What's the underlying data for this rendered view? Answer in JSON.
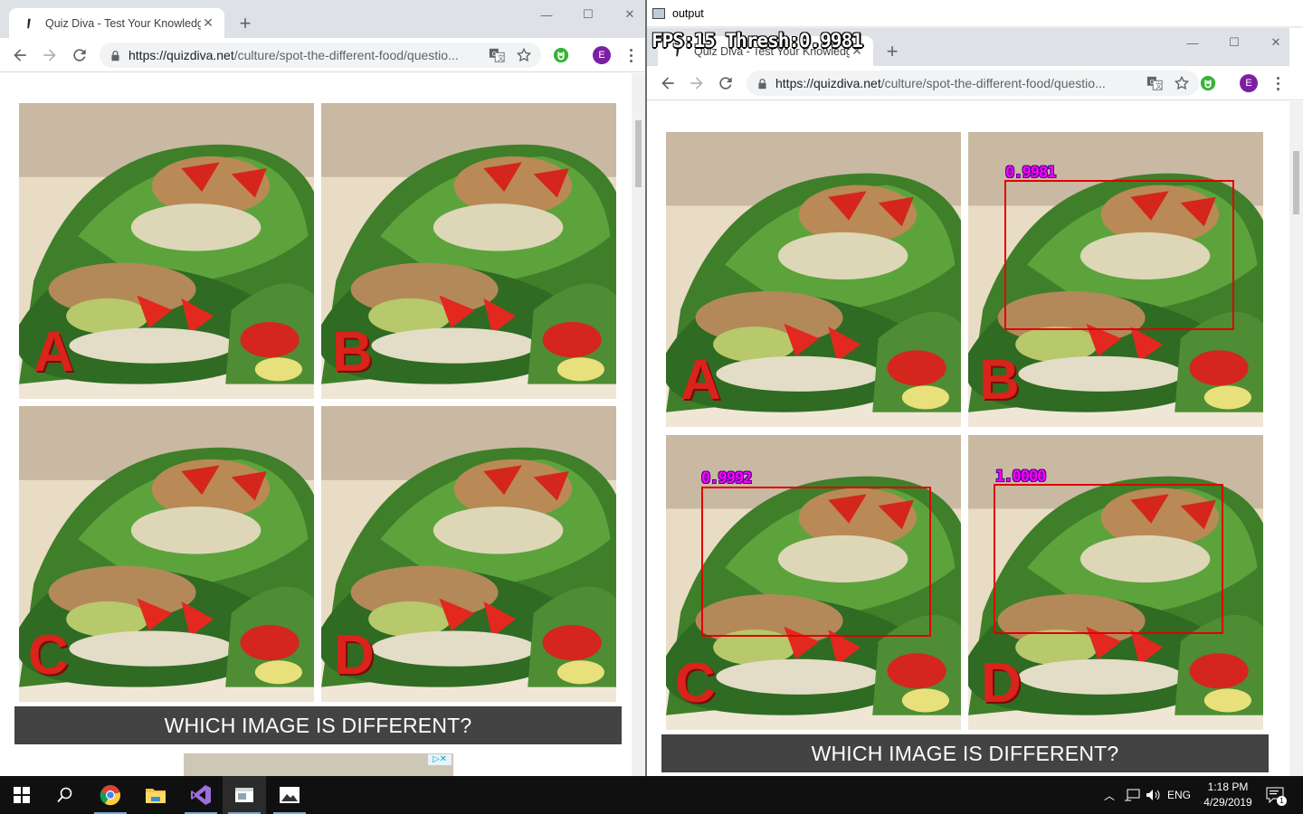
{
  "left_browser": {
    "tab_title": "Quiz Diva - Test Your Knowledge",
    "url_host": "https://quizdiva.net",
    "url_path": "/culture/spot-the-different-food/questio...",
    "profile_initial": "E",
    "tiles": [
      "A",
      "B",
      "C",
      "D"
    ],
    "banner": "WHICH IMAGE IS DIFFERENT?"
  },
  "output_window": {
    "title": "output",
    "hud": "FPS:15 Thresh:0.9981",
    "inner_tab_title": "Quiz Diva - Test Your Knowledge",
    "url_host": "https://quizdiva.net",
    "url_path": "/culture/spot-the-different-food/questio...",
    "profile_initial": "E",
    "tiles": [
      "A",
      "B",
      "C",
      "D"
    ],
    "detections": {
      "b": "0.9981",
      "c": "0.9992",
      "d": "1.0000"
    },
    "banner": "WHICH IMAGE IS DIFFERENT?"
  },
  "taskbar": {
    "items": [
      "start-icon",
      "search-icon",
      "chrome-icon",
      "file-explorer-icon",
      "visual-studio-icon",
      "app-window-icon",
      "image-viewer-icon"
    ],
    "language": "ENG",
    "time": "1:18 PM",
    "date": "4/29/2019",
    "notification_count": "1"
  },
  "colors": {
    "detection_box": "#e00000",
    "detection_score": "#ff00ff",
    "banner_bg": "#434343",
    "tile_letter": "#d9231b"
  }
}
